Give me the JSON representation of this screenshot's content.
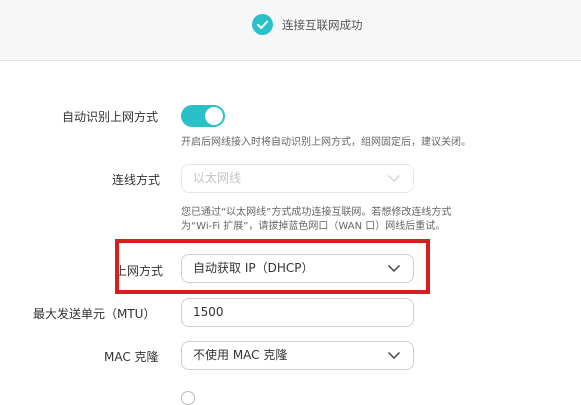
{
  "header": {
    "status_icon": "check-circle-icon",
    "status_text": "连接互联网成功",
    "accent_color": "#29c1c7"
  },
  "form": {
    "auto_detect": {
      "label": "自动识别上网方式",
      "enabled": true,
      "hint": "开启后网线接入时将自动识别上网方式，组网固定后，建议关闭。"
    },
    "connection": {
      "label": "连线方式",
      "value": "以太网线",
      "disabled": true,
      "hint_line1": "您已通过“以太网线”方式成功连接互联网。若想修改连线方式",
      "hint_line2": "为“Wi-Fi 扩展”，请拔掉蓝色网口（WAN 口）网线后重试。"
    },
    "internet_mode": {
      "label": "上网方式",
      "value": "自动获取 IP（DHCP）"
    },
    "mtu": {
      "label": "最大发送单元（MTU）",
      "value": "1500"
    },
    "mac_clone": {
      "label": "MAC 克隆",
      "value": "不使用 MAC 克隆"
    }
  },
  "annotation": {
    "highlight_color": "#d81e1e"
  }
}
